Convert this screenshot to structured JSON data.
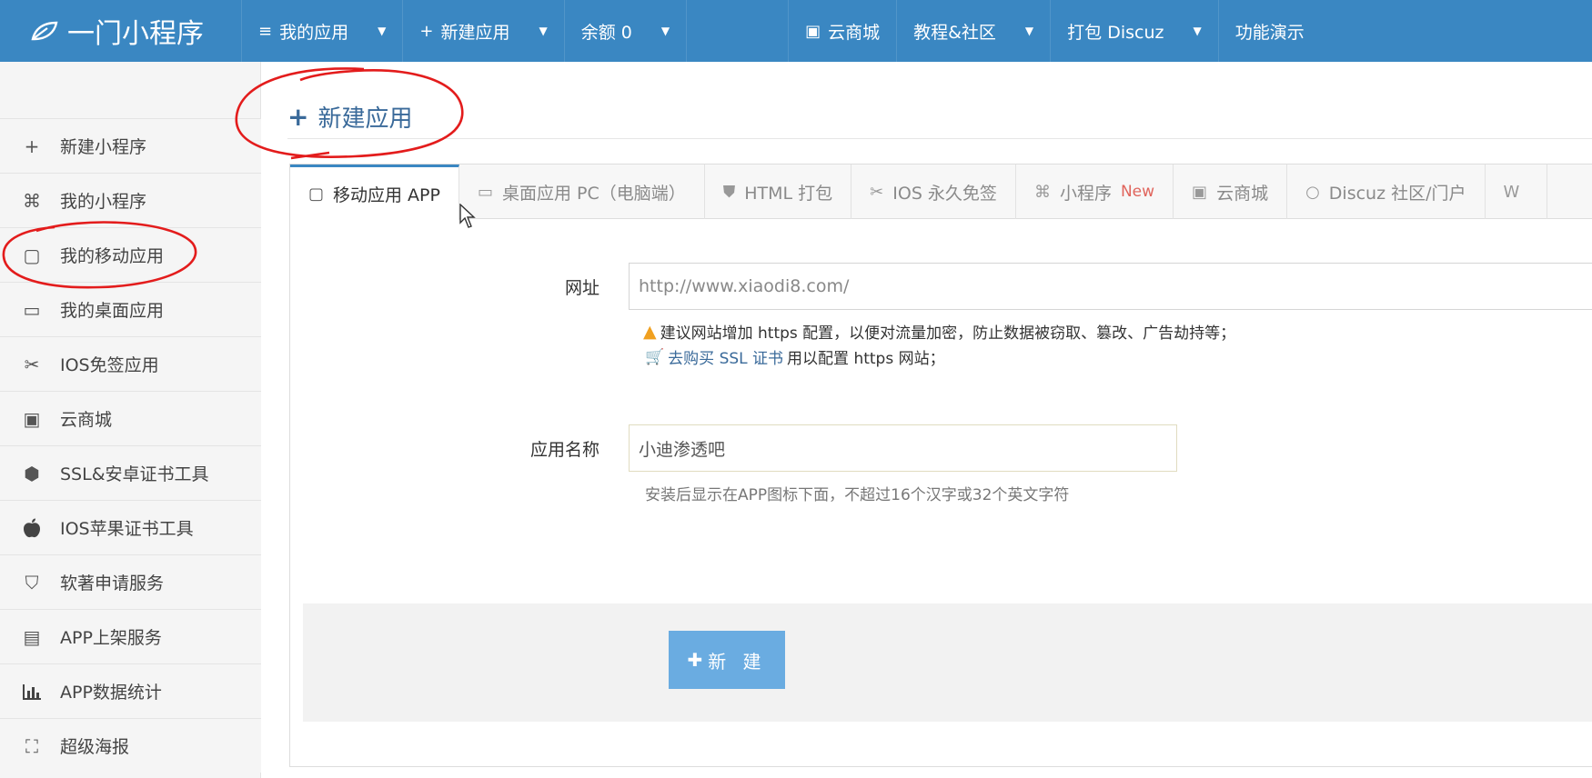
{
  "topbar": {
    "brand": "一门小程序",
    "nav": [
      {
        "icon": "menu-icon",
        "glyph": "≡",
        "label": "我的应用",
        "dropdown": true
      },
      {
        "icon": "plus-icon",
        "glyph": "+",
        "label": "新建应用",
        "dropdown": true
      },
      {
        "icon": "",
        "glyph": "",
        "label": "余额 0",
        "dropdown": true
      },
      {
        "icon": "",
        "glyph": "",
        "label": "",
        "dropdown": false
      },
      {
        "icon": "store-icon",
        "glyph": "▣",
        "label": "云商城",
        "dropdown": false
      },
      {
        "icon": "",
        "glyph": "",
        "label": "教程&社区",
        "dropdown": true
      },
      {
        "icon": "",
        "glyph": "",
        "label": "打包 Discuz",
        "dropdown": true
      },
      {
        "icon": "",
        "glyph": "",
        "label": "功能演示",
        "dropdown": false
      }
    ]
  },
  "sidebar": {
    "items": [
      {
        "icon": "plus-icon",
        "glyph": "+",
        "label": "新建小程序"
      },
      {
        "icon": "grid-icon",
        "glyph": "⌘",
        "label": "我的小程序"
      },
      {
        "icon": "mobile-icon",
        "glyph": "▢",
        "label": "我的移动应用"
      },
      {
        "icon": "desktop-icon",
        "glyph": "▭",
        "label": "我的桌面应用"
      },
      {
        "icon": "scissors-icon",
        "glyph": "✂",
        "label": "IOS免签应用"
      },
      {
        "icon": "store-icon",
        "glyph": "▣",
        "label": "云商城"
      },
      {
        "icon": "ssl-icon",
        "glyph": "⬢",
        "label": "SSL&安卓证书工具"
      },
      {
        "icon": "apple-icon",
        "glyph": "",
        "label": "IOS苹果证书工具"
      },
      {
        "icon": "shield-icon",
        "glyph": "⛉",
        "label": "软著申请服务"
      },
      {
        "icon": "app-store-icon",
        "glyph": "▤",
        "label": "APP上架服务"
      },
      {
        "icon": "bar-chart-icon",
        "glyph": "▮",
        "label": "APP数据统计"
      },
      {
        "icon": "poster-icon",
        "glyph": "⛶",
        "label": "超级海报"
      }
    ]
  },
  "main": {
    "title": "新建应用",
    "tabs": [
      {
        "icon": "mobile-icon",
        "glyph": "▢",
        "label": "移动应用 APP",
        "badge": ""
      },
      {
        "icon": "desktop-icon",
        "glyph": "▭",
        "label": "桌面应用 PC（电脑端）",
        "badge": ""
      },
      {
        "icon": "html5-icon",
        "glyph": "⛊",
        "label": "HTML 打包",
        "badge": ""
      },
      {
        "icon": "scissors-icon",
        "glyph": "✂",
        "label": "IOS 永久免签",
        "badge": ""
      },
      {
        "icon": "grid-icon",
        "glyph": "⌘",
        "label": "小程序",
        "badge": "New"
      },
      {
        "icon": "store-icon",
        "glyph": "▣",
        "label": "云商城",
        "badge": ""
      },
      {
        "icon": "discuz-icon",
        "glyph": "○",
        "label": "Discuz 社区/门户",
        "badge": ""
      },
      {
        "icon": "wordpress-icon",
        "glyph": "W",
        "label": "W",
        "badge": ""
      }
    ],
    "form": {
      "url_label": "网址",
      "url_placeholder": "http://www.xiaodi8.com/",
      "https_warning": "建议网站增加 https 配置，以便对流量加密，防止数据被窃取、篡改、广告劫持等；",
      "ssl_link": "去购买 SSL 证书",
      "ssl_suffix": "用以配置 https 网站；",
      "name_label": "应用名称",
      "name_value": "小迪渗透吧",
      "name_hint": "安装后显示在APP图标下面，不超过16个汉字或32个英文字符",
      "submit_label": "新 建"
    }
  }
}
